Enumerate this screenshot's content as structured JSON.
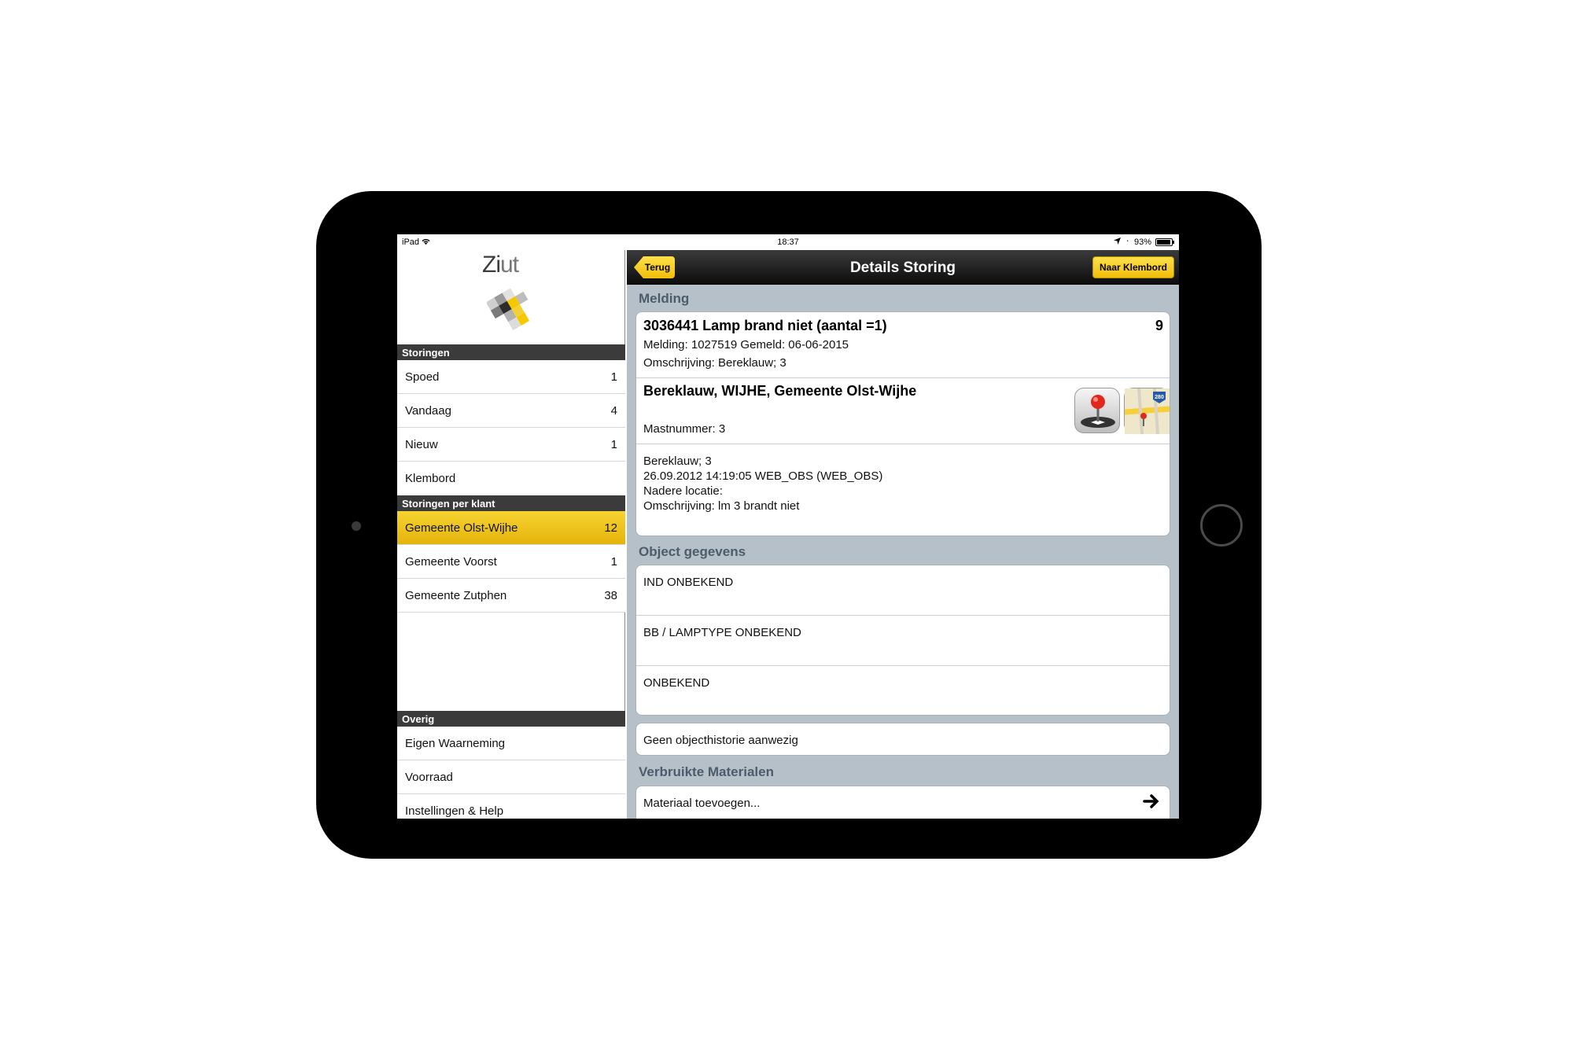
{
  "status_bar": {
    "device": "iPad",
    "time": "18:37",
    "battery": "93%",
    "battery_level": 0.93
  },
  "logo": {
    "text_a": "Zi",
    "text_b": "ut"
  },
  "sidebar": {
    "sections": [
      {
        "header": "Storingen",
        "items": [
          {
            "label": "Spoed",
            "count": "1"
          },
          {
            "label": "Vandaag",
            "count": "4"
          },
          {
            "label": "Nieuw",
            "count": "1"
          },
          {
            "label": "Klembord",
            "count": ""
          }
        ]
      },
      {
        "header": "Storingen per klant",
        "items": [
          {
            "label": "Gemeente Olst-Wijhe",
            "count": "12",
            "selected": true
          },
          {
            "label": "Gemeente Voorst",
            "count": "1"
          },
          {
            "label": "Gemeente Zutphen",
            "count": "38"
          }
        ]
      },
      {
        "header": "Overig",
        "items": [
          {
            "label": "Eigen Waarneming",
            "count": ""
          },
          {
            "label": "Voorraad",
            "count": ""
          },
          {
            "label": "Instellingen & Help",
            "count": ""
          }
        ]
      }
    ]
  },
  "navbar": {
    "back_label": "Terug",
    "title": "Details Storing",
    "right_label": "Naar Klembord"
  },
  "melding": {
    "section_label": "Melding",
    "title": "3036441 Lamp brand niet (aantal =1)",
    "title_count": "9",
    "line1": "Melding: 1027519 Gemeld: 06-06-2015",
    "line2": "Omschrijving: Bereklauw;  3",
    "location_title": "Bereklauw, WIJHE, Gemeente Olst-Wijhe",
    "mastnummer": "Mastnummer: 3",
    "map_badge": "280",
    "details": [
      "Bereklauw;  3",
      "26.09.2012 14:19:05  WEB_OBS (WEB_OBS)",
      "Nadere locatie:",
      "Omschrijving: lm 3 brandt niet"
    ]
  },
  "object": {
    "section_label": "Object gegevens",
    "rows": [
      "IND ONBEKEND",
      "BB / LAMPTYPE ONBEKEND",
      "ONBEKEND"
    ],
    "history": "Geen objecthistorie aanwezig"
  },
  "materialen": {
    "section_label": "Verbruikte Materialen",
    "add_label": "Materiaal toevoegen..."
  },
  "colors": {
    "accent": "#f5c518",
    "section_text": "#4d5c6c",
    "pane_bg": "#b5c0c9"
  },
  "icons": [
    "wifi-icon",
    "location-arrow-icon",
    "bluetooth-icon",
    "battery-icon",
    "joystick-pin-icon",
    "maps-icon",
    "arrow-right-icon"
  ]
}
